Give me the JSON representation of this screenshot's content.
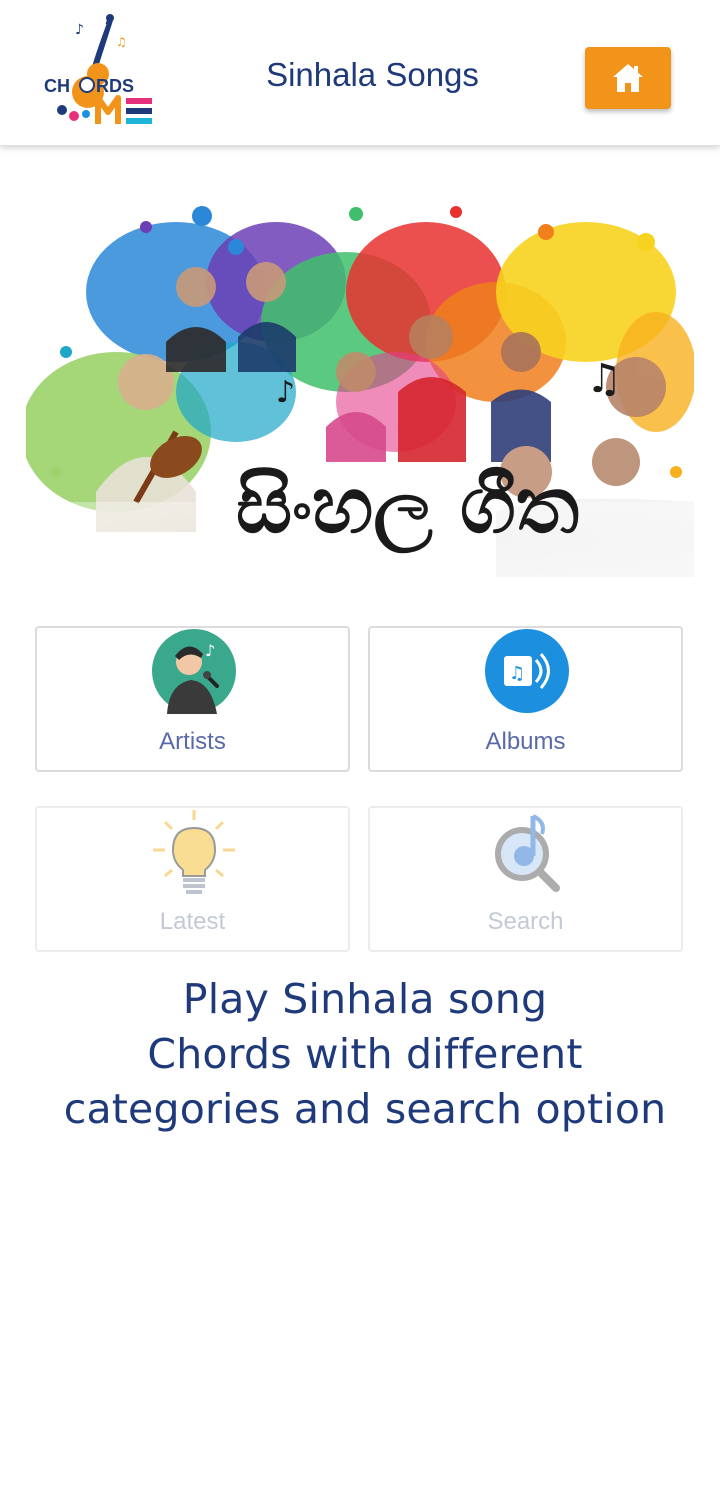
{
  "header": {
    "logo_text": "CHORDS ME",
    "title": "Sinhala Songs",
    "home_icon": "home-icon"
  },
  "banner": {
    "caption_sinhala": "සිංහල ගීත"
  },
  "categories": [
    {
      "label": "Artists",
      "icon": "singer-icon",
      "color": "#3aa88c"
    },
    {
      "label": "Albums",
      "icon": "album-icon",
      "color": "#1d8fdf"
    },
    {
      "label": "Latest",
      "icon": "lightbulb-icon",
      "color": "#f5c33b"
    },
    {
      "label": "Search",
      "icon": "music-search-icon",
      "color": "#5b8bd6"
    }
  ],
  "tagline": {
    "line1": "Play Sinhala song",
    "line2": "Chords with different",
    "line3": "categories and search option"
  },
  "colors": {
    "accent": "#f29419",
    "title": "#1f3a7a",
    "label": "#5a6aa8"
  }
}
